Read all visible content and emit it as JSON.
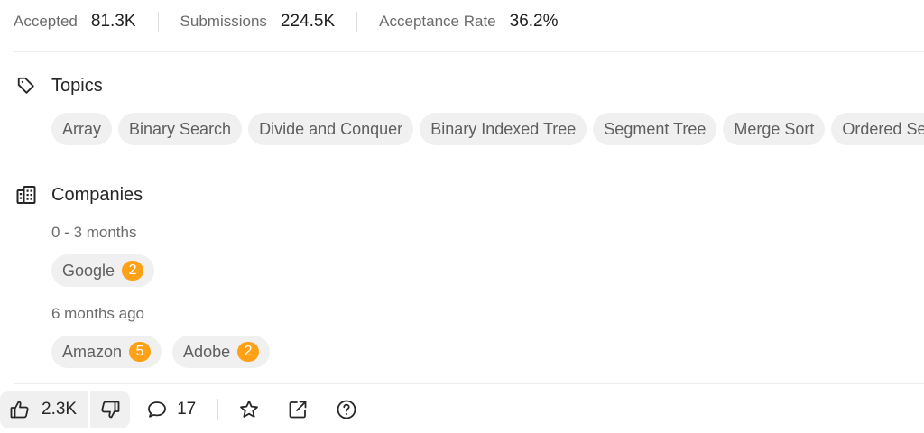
{
  "stats": {
    "accepted_label": "Accepted",
    "accepted_value": "81.3K",
    "submissions_label": "Submissions",
    "submissions_value": "224.5K",
    "acceptance_rate_label": "Acceptance Rate",
    "acceptance_rate_value": "36.2%"
  },
  "topics": {
    "title": "Topics",
    "icon": "tag-icon",
    "items": [
      "Array",
      "Binary Search",
      "Divide and Conquer",
      "Binary Indexed Tree",
      "Segment Tree",
      "Merge Sort",
      "Ordered Set"
    ]
  },
  "companies": {
    "title": "Companies",
    "icon": "building-icon",
    "groups": [
      {
        "period": "0 - 3 months",
        "items": [
          {
            "name": "Google",
            "count": "2"
          }
        ]
      },
      {
        "period": "6 months ago",
        "items": [
          {
            "name": "Amazon",
            "count": "5"
          },
          {
            "name": "Adobe",
            "count": "2"
          }
        ]
      }
    ]
  },
  "toolbar": {
    "likes": "2.3K",
    "comments": "17",
    "icons": [
      "thumbs-up-icon",
      "thumbs-down-icon",
      "comment-icon",
      "star-icon",
      "share-icon",
      "help-icon"
    ]
  },
  "colors": {
    "badge": "#ffa116",
    "chip_background": "#f0f0f0",
    "chip_text": "#5f5f5f",
    "divider": "#ececec"
  }
}
